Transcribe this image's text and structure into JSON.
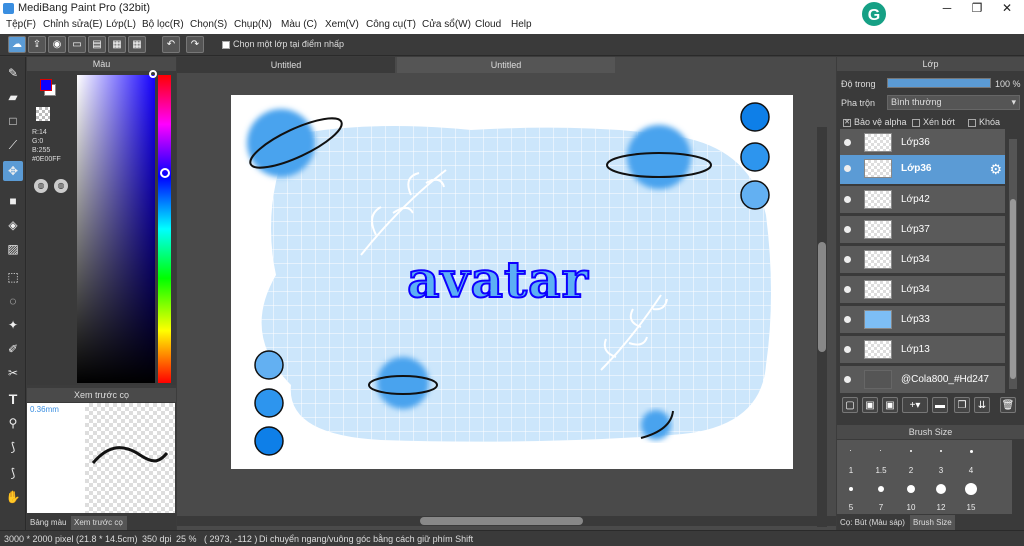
{
  "window": {
    "title": "MediBang Paint Pro (32bit)",
    "grammarly": "G",
    "min": "─",
    "max": "❐",
    "close": "✕"
  },
  "menu": [
    "Tệp(F)",
    "Chỉnh sửa(E)",
    "Lớp(L)",
    "Bộ lọc(R)",
    "Chọn(S)",
    "Chụp(N)",
    "Màu (C)",
    "Xem(V)",
    "Công cụ(T)",
    "Cửa sổ(W)",
    "Cloud",
    "Help"
  ],
  "toolbar": {
    "checkbox_label": "Chọn một lớp tại điểm nhấp"
  },
  "color_panel": {
    "title": "Màu",
    "r": "R:14",
    "g": "G:0",
    "b": "B:255",
    "hex": "#0E00FF",
    "fg": "#0e00ff"
  },
  "brush_preview": {
    "title": "Xem trước cọ",
    "size": "0.36mm",
    "tab1": "Bảng màu",
    "tab2": "Xem trước cọ"
  },
  "tabs": {
    "tab1": "Untitled",
    "tab2": "Untitled"
  },
  "artwork": {
    "text": "avatar"
  },
  "layer_panel": {
    "title": "Lớp",
    "opacity_label": "Độ trong",
    "opacity_value": "100 %",
    "blend_label": "Pha trộn",
    "blend_value": "Bình thường",
    "protect_alpha": "Bảo vệ alpha",
    "clipping": "Xén bớt",
    "lock": "Khóa",
    "layers": [
      {
        "name": "Lớp36"
      },
      {
        "name": "Lớp36"
      },
      {
        "name": "Lớp42"
      },
      {
        "name": "Lớp37"
      },
      {
        "name": "Lớp34"
      },
      {
        "name": "Lớp34"
      },
      {
        "name": "Lớp33"
      },
      {
        "name": "Lớp13"
      },
      {
        "name": "@Cola800_#Hd247"
      }
    ]
  },
  "brush_size": {
    "title": "Brush Size",
    "sizes": [
      "1",
      "1.5",
      "2",
      "3",
      "4",
      "5",
      "7",
      "10",
      "12",
      "15"
    ],
    "tab1": "Cọ: Bút (Màu sáp)",
    "tab2": "Brush Size"
  },
  "status": {
    "size": "3000 * 2000 pixel",
    "cm": "(21.8 * 14.5cm)",
    "dpi": "350 dpi",
    "zoom": "25 %",
    "coords": "( 2973, -112 )",
    "hint": "Di chuyển ngang/vuông góc bằng cách giữ phím Shift"
  }
}
